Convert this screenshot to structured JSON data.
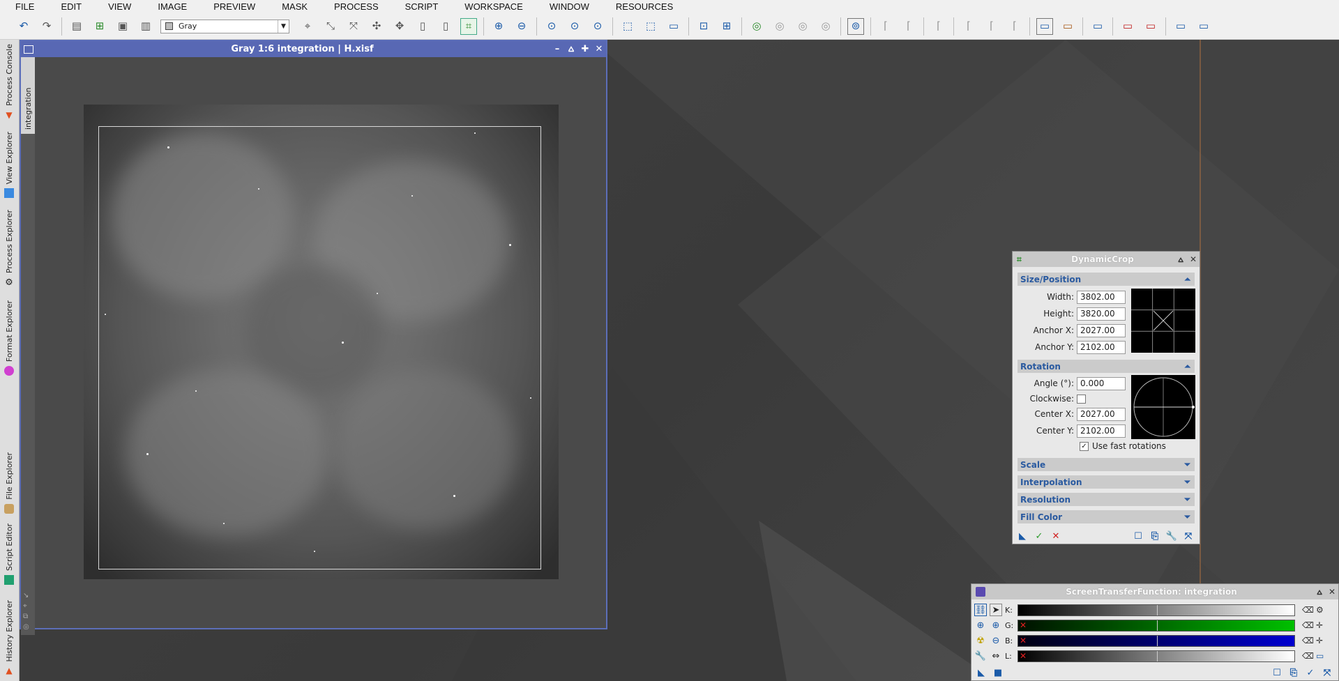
{
  "menu": [
    "FILE",
    "EDIT",
    "VIEW",
    "IMAGE",
    "PREVIEW",
    "MASK",
    "PROCESS",
    "SCRIPT",
    "WORKSPACE",
    "WINDOW",
    "RESOURCES"
  ],
  "toolbar": {
    "view_select_value": "Gray"
  },
  "left_dock": {
    "tabs": [
      "Process Console",
      "View Explorer",
      "Process Explorer",
      "Format Explorer",
      "File Explorer",
      "Script Editor",
      "History Explorer"
    ]
  },
  "image_window": {
    "title": "Gray 1:6 integration | H.xisf",
    "side_tab": "integration"
  },
  "dynamic_crop": {
    "title": "DynamicCrop",
    "size_position": {
      "header": "Size/Position",
      "width_label": "Width:",
      "width": "3802.00",
      "height_label": "Height:",
      "height": "3820.00",
      "anchor_x_label": "Anchor X:",
      "anchor_x": "2027.00",
      "anchor_y_label": "Anchor Y:",
      "anchor_y": "2102.00"
    },
    "rotation": {
      "header": "Rotation",
      "angle_label": "Angle (°):",
      "angle": "0.000",
      "clockwise_label": "Clockwise:",
      "center_x_label": "Center X:",
      "center_x": "2027.00",
      "center_y_label": "Center Y:",
      "center_y": "2102.00",
      "fast_rotations_label": "Use fast rotations",
      "fast_rotations_checked": true
    },
    "collapsed_sections": [
      "Scale",
      "Interpolation",
      "Resolution",
      "Fill Color"
    ]
  },
  "stf": {
    "title": "ScreenTransferFunction: integration",
    "channels": [
      {
        "label": "K:",
        "color_from": "#000000",
        "color_to": "#ffffff",
        "disabled": false
      },
      {
        "label": "G:",
        "color_from": "#001000",
        "color_to": "#00c000",
        "disabled": true
      },
      {
        "label": "B:",
        "color_from": "#000010",
        "color_to": "#0000d0",
        "disabled": true
      },
      {
        "label": "L:",
        "color_from": "#000000",
        "color_to": "#ffffff",
        "disabled": true
      }
    ]
  },
  "colors": {
    "window_title_bg": "#5868b4",
    "section_header_text": "#2a5aa0",
    "accent_green": "#4a8"
  }
}
